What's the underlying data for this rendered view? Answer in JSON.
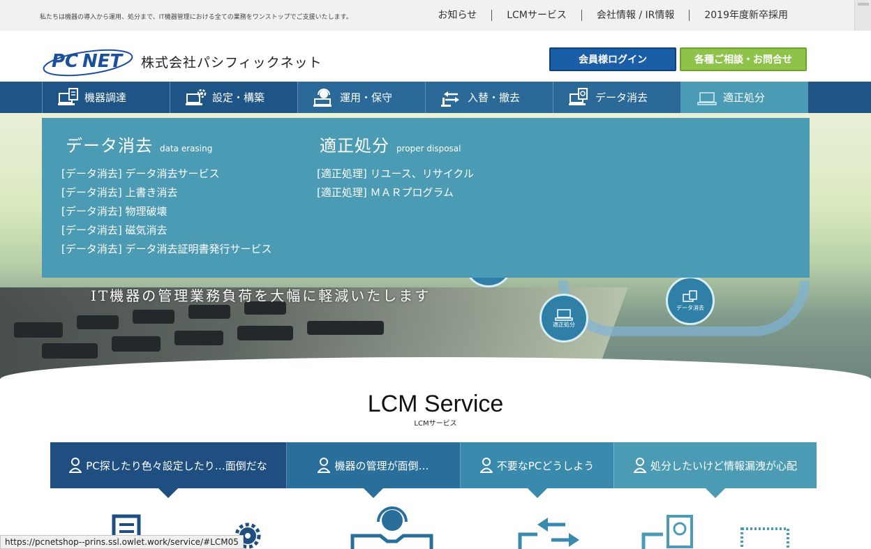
{
  "topbar": {
    "tagline": "私たちは機器の導入から運用、処分まで、IT機器管理における全ての業務をワンストップでご支援いたします。",
    "links": [
      "お知らせ",
      "LCMサービス",
      "会社情報 / IR情報",
      "2019年度新卒採用"
    ]
  },
  "header": {
    "logo_text": "PC NET",
    "company_name": "株式会社パシフィックネット",
    "login_button": "会員様ログイン",
    "contact_button": "各種ご相談・お問合せ"
  },
  "nav": {
    "items": [
      {
        "label": "機器調達",
        "icon": "pc-document-icon"
      },
      {
        "label": "設定・構築",
        "icon": "pc-gear-icon"
      },
      {
        "label": "運用・保守",
        "icon": "headset-operator-icon"
      },
      {
        "label": "入替・撤去",
        "icon": "swap-arrows-icon"
      },
      {
        "label": "データ消去",
        "icon": "pc-disk-erase-icon"
      },
      {
        "label": "適正処分",
        "icon": "laptop-outline-icon"
      }
    ]
  },
  "dropdown": {
    "left": {
      "title": "データ消去",
      "subtitle": "data erasing",
      "links": [
        "[データ消去] データ消去サービス",
        "[データ消去] 上書き消去",
        "[データ消去] 物理破壊",
        "[データ消去] 磁気消去",
        "[データ消去] データ消去証明書発行サービス"
      ]
    },
    "right": {
      "title": "適正処分",
      "subtitle": "proper disposal",
      "links": [
        "[適正処理] リユース、リサイクル",
        "[適正処理] ＭＡＲプログラム"
      ]
    }
  },
  "hero": {
    "slogan": "IT機器の管理業務負荷を大幅に軽減いたします",
    "circle_labels": [
      "適正処分",
      "データ消去"
    ]
  },
  "lcm": {
    "title": "LCM Service",
    "subtitle": "LCMサービス",
    "tabs": [
      {
        "label": "PC探したり色々設定したり…面倒だな",
        "color": "#1f4f80"
      },
      {
        "label": "機器の管理が面倒…",
        "color": "#2a6f9c"
      },
      {
        "label": "不要なPCどうしよう",
        "color": "#3a8aae"
      },
      {
        "label": "処分したいけど情報漏洩が心配",
        "color": "#4a9bb3"
      }
    ]
  },
  "statusbar": {
    "url": "https://pcnetshop--prins.ssl.owlet.work/service/#LCM05"
  },
  "colors": {
    "nav_dark": "#1f5586",
    "accent_teal": "#4a9bb3",
    "login_blue": "#1a5ea8",
    "contact_green": "#8ec24a"
  }
}
